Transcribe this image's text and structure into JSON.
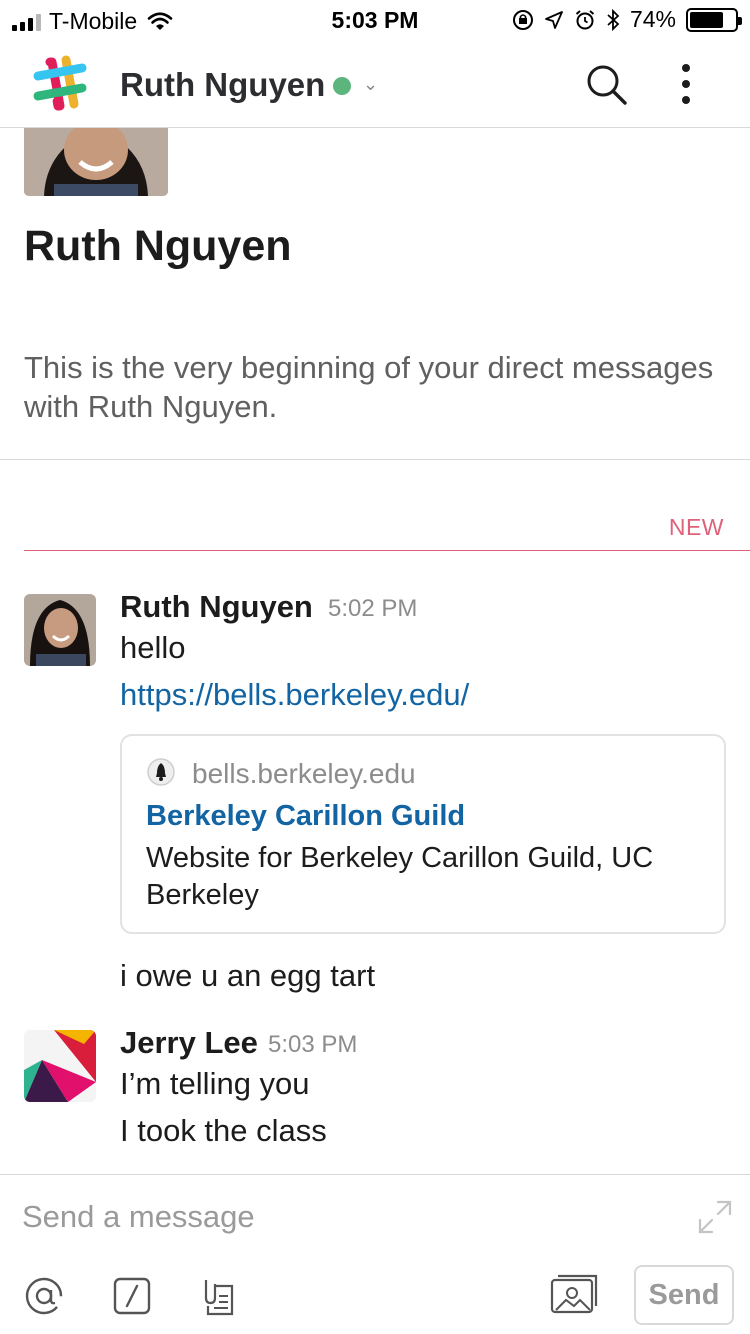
{
  "status_bar": {
    "carrier": "T-Mobile",
    "time": "5:03 PM",
    "battery_percent": "74%",
    "battery_level": 0.74,
    "icons": [
      "signal-icon",
      "wifi-icon",
      "orientation-lock-icon",
      "location-icon",
      "alarm-icon",
      "bluetooth-icon",
      "battery-icon"
    ]
  },
  "header": {
    "title": "Ruth Nguyen",
    "presence": "active",
    "presence_color": "#5cb57c",
    "icons": [
      "slack-logo-icon",
      "chevron-down-icon",
      "search-icon",
      "more-vertical-icon"
    ]
  },
  "intro": {
    "name": "Ruth Nguyen",
    "text": "This is the very beginning of your direct messages with Ruth Nguyen."
  },
  "new_divider": {
    "label": "NEW",
    "color": "#e0627a"
  },
  "messages": [
    {
      "author": "Ruth Nguyen",
      "time": "5:02 PM",
      "lines": [
        "hello"
      ],
      "link": "https://bells.berkeley.edu/",
      "unfurl": {
        "domain": "bells.berkeley.edu",
        "title": "Berkeley Carillon Guild",
        "description": "Website for Berkeley Carillon Guild, UC Berkeley"
      },
      "after": "i owe u an egg tart"
    },
    {
      "author": "Jerry Lee",
      "time": "5:03 PM",
      "lines": [
        "I’m telling you",
        "I took the class"
      ]
    }
  ],
  "composer": {
    "placeholder": "Send a message",
    "send_label": "Send",
    "icons": [
      "expand-icon",
      "mention-icon",
      "slash-command-icon",
      "attachment-icon",
      "photo-icon"
    ]
  },
  "colors": {
    "link": "#1264a3",
    "text": "#1d1c1d",
    "muted": "#8c8c8c"
  }
}
